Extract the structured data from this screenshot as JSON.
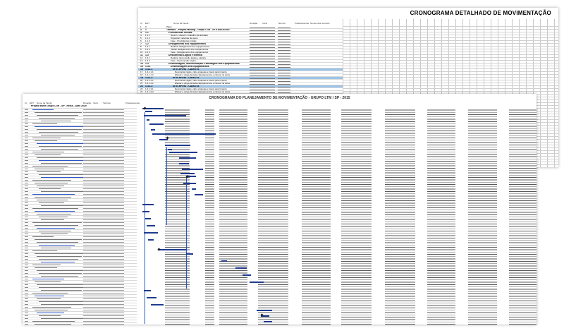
{
  "back_sheet": {
    "title": "CRONOGRAMA DETALHADO DE MOVIMENTAÇÃO",
    "header_cells": [
      "Id",
      "EDT",
      "",
      "Nome da Tarefa",
      "Duração",
      "Início",
      "Término",
      "Predecessoras",
      "Nomes dos recursos"
    ],
    "rows": [
      {
        "id": "1",
        "edt": "0",
        "name": "Plano",
        "bold": false
      },
      {
        "id": "2",
        "edt": "1",
        "name": "Tarefa01 - Projeto Moving - Grupo LTM - 29 a 30/03/2015",
        "bold": true
      },
      {
        "id": "3",
        "edt": "1.1",
        "name": "Providências Iniciais",
        "bold": true
      },
      {
        "id": "4",
        "edt": "1.1.1",
        "name": "Reunir e discutir o trabalho da atividade",
        "bold": false
      },
      {
        "id": "5",
        "edt": "1.1.2",
        "name": "Organizar materiais de apoio",
        "bold": false
      },
      {
        "id": "6",
        "edt": "1.1.3",
        "name": "Fase - Providências Iniciais",
        "bold": false
      },
      {
        "id": "7",
        "edt": "1.2",
        "name": "Desligamento dos equipamentos",
        "bold": true
      },
      {
        "id": "8",
        "edt": "1.2.1",
        "name": "Realizar desligamento dos equipamentos",
        "bold": false
      },
      {
        "id": "9",
        "edt": "1.2.2",
        "name": "Validar desligamento dos equipamentos",
        "bold": false
      },
      {
        "id": "10",
        "edt": "1.2.3",
        "name": "Fase - Desligamento dos equipamentos",
        "bold": false
      },
      {
        "id": "11",
        "edt": "1.3",
        "name": "Desconexão Lógica e Elétrica",
        "bold": true
      },
      {
        "id": "12",
        "edt": "1.3.1",
        "name": "Realizar desconexão lógica e elétrica",
        "bold": false
      },
      {
        "id": "13",
        "edt": "1.3.2",
        "name": "Fase - Desconexão Lógica",
        "bold": false
      },
      {
        "id": "14",
        "edt": "1.4",
        "name": "Desmontagem, Movimentação e Montagem dos Equipamentos",
        "bold": true
      },
      {
        "id": "15",
        "edt": "1.4.1",
        "name": "Desmontagem dos Equipamentos",
        "bold": true
      },
      {
        "id": "16",
        "edt": "1.4.1.1",
        "name": "SITE APOIO - CAIXA 01",
        "bold": true,
        "hl": true
      },
      {
        "id": "17",
        "edt": "1.4.1.1.1",
        "name": "Desmontar rágios, cabo etiquetas e travar para Imperia",
        "bold": false
      },
      {
        "id": "18",
        "edt": "1.4.1.1.2",
        "name": "Efetuar a carga, Encaixe Equipamentos e colocar na caixa",
        "bold": false
      },
      {
        "id": "19",
        "edt": "1.4.1.2",
        "name": "SITE APOIO - CAIXA 02",
        "bold": true,
        "hl": true
      },
      {
        "id": "20",
        "edt": "1.4.1.2.1",
        "name": "Desmontar rágios, cabo etiquetas e travar para Imperia",
        "bold": false
      },
      {
        "id": "21",
        "edt": "1.4.1.2.2",
        "name": "Efetuar a carga, Encaixe Equipamentos e colocar na caixa",
        "bold": false
      },
      {
        "id": "22",
        "edt": "1.4.1.3",
        "name": "SITE APOIO - CAIXA 03",
        "bold": true,
        "hl": true
      },
      {
        "id": "23",
        "edt": "1.4.1.3.1",
        "name": "Desmontar rágios, cabo etiquetas e travar para Imperia",
        "bold": false
      },
      {
        "id": "24",
        "edt": "1.4.1.3.2",
        "name": "Efetuar a carga, Encaixe Equipamentos e colocar na caixa",
        "bold": false
      },
      {
        "id": "25",
        "edt": "1.4.1.4",
        "name": "SITE APOIO - CAIXA 04",
        "bold": true,
        "hl": true
      }
    ]
  },
  "front_sheet": {
    "title": "CRONOGRAMA DO PLANEJAMENTO DE MOVIMENTAÇÃO - GRUPO LTM / SP - 2015",
    "header_cells": [
      "Id",
      "EDT",
      "Nome da Tarefa",
      "Duração",
      "Início",
      "Término",
      "Predecessoras"
    ],
    "project_title": "Projeto Move Grupo LTM - SP - Reiss - Abril 2015"
  }
}
